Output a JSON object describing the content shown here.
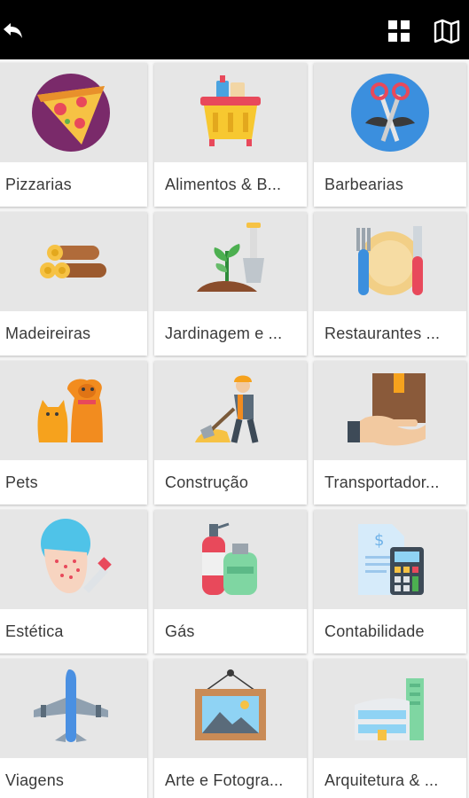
{
  "toolbar": {
    "back_icon": "back-arrow-icon",
    "grid_icon": "grid-view-icon",
    "map_icon": "map-icon"
  },
  "categories": [
    {
      "label": "Pizzarias",
      "icon": "pizza-icon"
    },
    {
      "label": "Alimentos & B...",
      "icon": "grocery-basket-icon"
    },
    {
      "label": "Barbearias",
      "icon": "scissors-mustache-icon"
    },
    {
      "label": "Madeireiras",
      "icon": "wood-logs-icon"
    },
    {
      "label": "Jardinagem e ...",
      "icon": "plant-shovel-icon"
    },
    {
      "label": "Restaurantes ...",
      "icon": "plate-cutlery-icon"
    },
    {
      "label": "Pets",
      "icon": "cat-dog-icon"
    },
    {
      "label": "Construção",
      "icon": "construction-worker-icon"
    },
    {
      "label": "Transportador...",
      "icon": "package-hand-icon"
    },
    {
      "label": "Estética",
      "icon": "facial-treatment-icon"
    },
    {
      "label": "Gás",
      "icon": "gas-cylinder-icon"
    },
    {
      "label": "Contabilidade",
      "icon": "calculator-document-icon"
    },
    {
      "label": "Viagens",
      "icon": "airplane-icon"
    },
    {
      "label": "Arte e Fotogra...",
      "icon": "framed-picture-icon"
    },
    {
      "label": "Arquitetura & ...",
      "icon": "building-icon"
    }
  ]
}
